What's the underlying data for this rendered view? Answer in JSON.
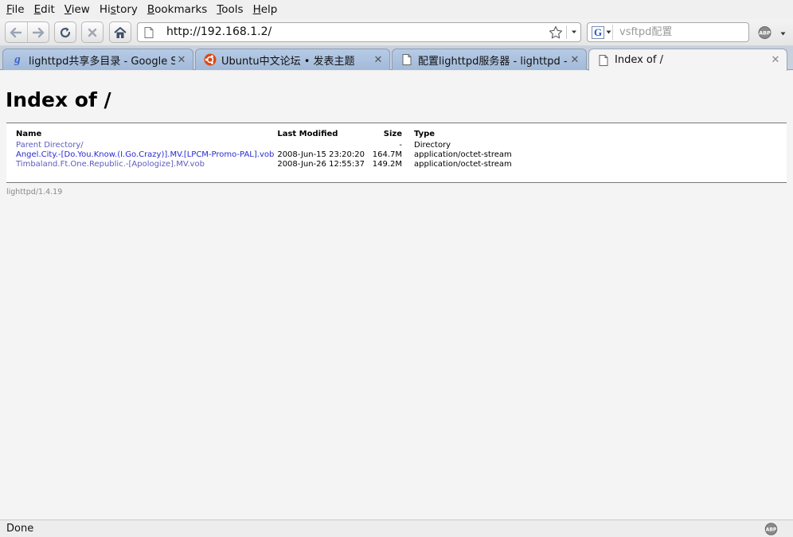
{
  "menu": [
    {
      "label": "File",
      "key": "F",
      "rest": "ile"
    },
    {
      "label": "Edit",
      "key": "E",
      "rest": "dit"
    },
    {
      "label": "View",
      "key": "V",
      "rest": "iew"
    },
    {
      "label": "History",
      "pre": "Hi",
      "key": "s",
      "rest": "tory"
    },
    {
      "label": "Bookmarks",
      "key": "B",
      "rest": "ookmarks"
    },
    {
      "label": "Tools",
      "key": "T",
      "rest": "ools"
    },
    {
      "label": "Help",
      "key": "H",
      "rest": "elp"
    }
  ],
  "nav": {
    "url": "http://192.168.1.2/",
    "search_placeholder": "vsftpd配置",
    "search_engine_letter": "G",
    "addon_label": "ABP",
    "icons": {
      "back": "arrow-left-icon",
      "forward": "arrow-right-icon",
      "reload": "reload-icon",
      "stop": "stop-icon",
      "home": "home-icon",
      "bookmark": "star-icon"
    }
  },
  "tabs": [
    {
      "title": "lighttpd共享多目录 - Google S...",
      "icon": "google-icon",
      "active": false
    },
    {
      "title": "Ubuntu中文论坛 • 发表主题",
      "icon": "ubuntu-icon",
      "active": false
    },
    {
      "title": "配置lighttpd服务器 - lighttpd - ...",
      "icon": "page-icon",
      "active": false
    },
    {
      "title": "Index of /",
      "icon": "page-icon",
      "active": true
    }
  ],
  "page": {
    "heading": "Index of /",
    "columns": {
      "name": "Name",
      "modified": "Last Modified",
      "size": "Size",
      "type": "Type"
    },
    "rows": [
      {
        "name": "Parent Directory/",
        "modified": "",
        "size": "-",
        "type": "Directory"
      },
      {
        "name": "Angel.City.-[Do.You.Know.(I.Go.Crazy)].MV.[LPCM-Promo-PAL].vob",
        "modified": "2008-Jun-15 23:20:20",
        "size": "164.7M",
        "type": "application/octet-stream"
      },
      {
        "name": "Timbaland.Ft.One.Republic.-[Apologize].MV.vob",
        "modified": "2008-Jun-26 12:55:37",
        "size": "149.2M",
        "type": "application/octet-stream"
      }
    ],
    "footer": "lighttpd/1.4.19"
  },
  "status": {
    "text": "Done"
  },
  "colors": {
    "link": "#2a2ad0",
    "visited_link": "#5b5bc0",
    "tab_inactive": "#a9bfdc"
  }
}
